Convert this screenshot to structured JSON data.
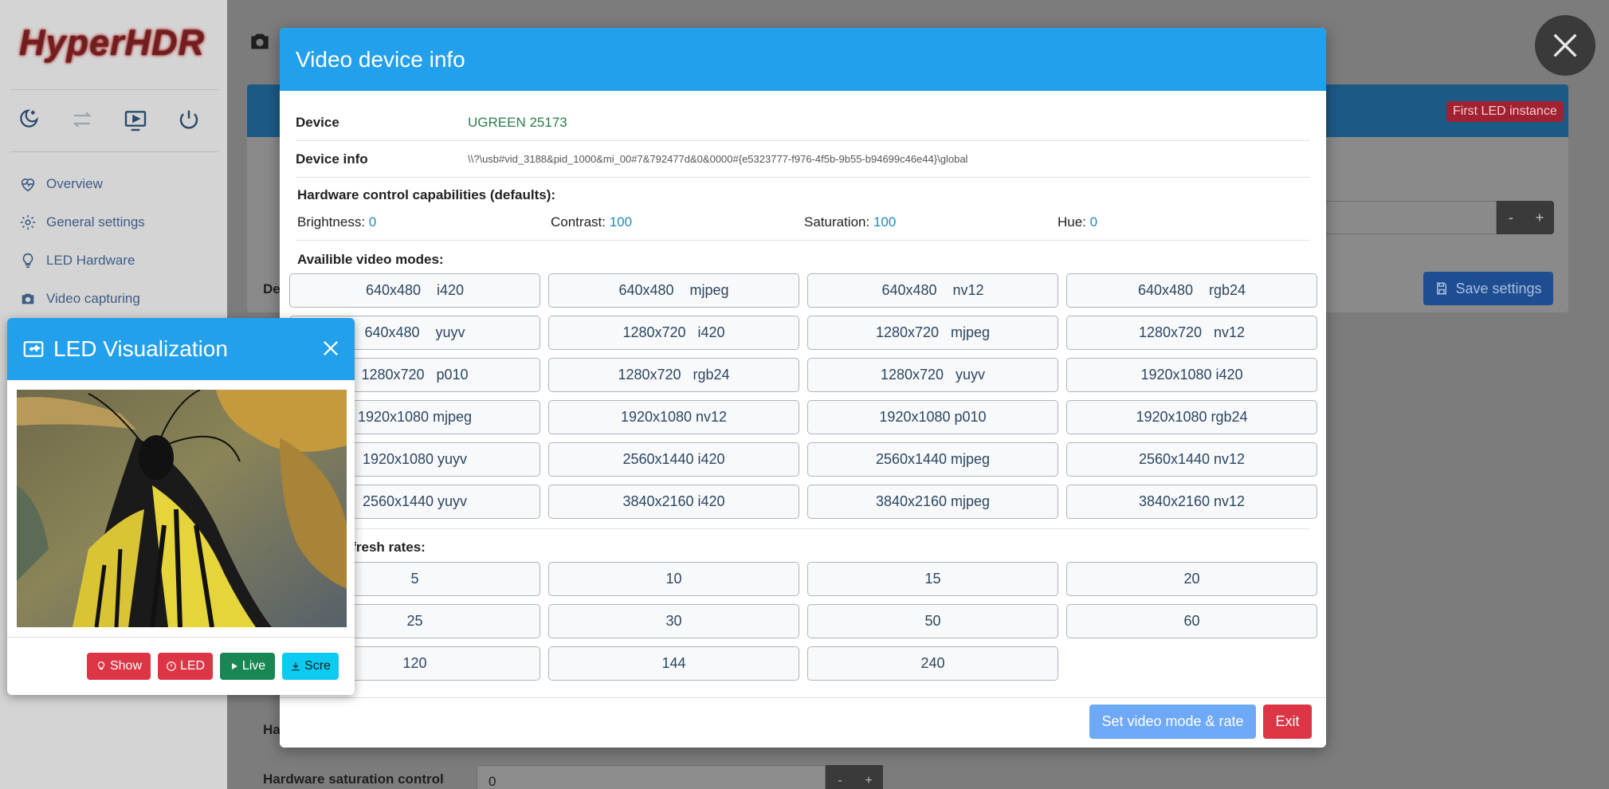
{
  "sidebar": {
    "logo": "HyperHDR",
    "nav": [
      "Overview",
      "General settings",
      "LED Hardware",
      "Video capturing"
    ]
  },
  "background": {
    "instance_badge": "First LED instance",
    "save_label": "Save settings",
    "partial_label_1": "De",
    "partial_label_2": "Ha",
    "saturation_label": "Hardware saturation control",
    "saturation_value": "0",
    "stepper_minus": "-",
    "stepper_plus": "+"
  },
  "modal": {
    "title": "Video device info",
    "device_label": "Device",
    "device_value": "UGREEN 25173",
    "info_label": "Device info",
    "info_value": "\\\\?\\usb#vid_3188&pid_1000&mi_00#7&792477d&0&0000#{e5323777-f976-4f5b-9b55-b94699c46e44}\\global",
    "caps_title": "Hardware control capabilities (defaults):",
    "caps": [
      {
        "label": "Brightness:",
        "value": "0"
      },
      {
        "label": "Contrast:",
        "value": "100"
      },
      {
        "label": "Saturation:",
        "value": "100"
      },
      {
        "label": "Hue:",
        "value": "0"
      }
    ],
    "modes_title": "Availible video modes:",
    "modes": [
      "640x480    i420",
      "640x480    mjpeg",
      "640x480    nv12",
      "640x480    rgb24",
      "640x480    yuyv",
      "1280x720   i420",
      "1280x720   mjpeg",
      "1280x720   nv12",
      "1280x720   p010",
      "1280x720   rgb24",
      "1280x720   yuyv",
      "1920x1080 i420",
      "1920x1080 mjpeg",
      "1920x1080 nv12",
      "1920x1080 p010",
      "1920x1080 rgb24",
      "1920x1080 yuyv",
      "2560x1440 i420",
      "2560x1440 mjpeg",
      "2560x1440 nv12",
      "2560x1440 yuyv",
      "3840x2160 i420",
      "3840x2160 mjpeg",
      "3840x2160 nv12"
    ],
    "rates_title": "e refresh rates:",
    "rates": [
      "5",
      "10",
      "15",
      "20",
      "25",
      "30",
      "50",
      "60",
      "120",
      "144",
      "240"
    ],
    "set_label": "Set video mode & rate",
    "exit_label": "Exit"
  },
  "ledviz": {
    "title": "LED Visualization",
    "buttons": [
      {
        "label": "Show",
        "color": "#dc3545"
      },
      {
        "label": "LED",
        "color": "#dc3545"
      },
      {
        "label": "Live",
        "color": "#198754"
      },
      {
        "label": "Scre",
        "color": "#0dcaf0"
      }
    ]
  }
}
